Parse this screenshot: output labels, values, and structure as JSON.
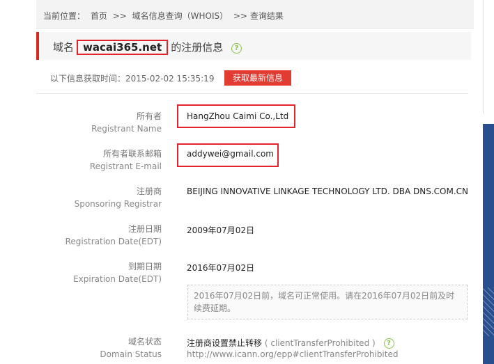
{
  "breadcrumb": {
    "prefix": "当前位置：",
    "home": "首页",
    "sep": ">>",
    "section": "域名信息查询（WHOIS）",
    "current": ">> 查询结果"
  },
  "title": {
    "prefix": "域名",
    "domain": "wacai365.net",
    "suffix": "的注册信息",
    "help": "?"
  },
  "fetch": {
    "text": "以下信息获取时间：2015-02-02 15:35:19",
    "button": "获取最新信息"
  },
  "fields": [
    {
      "label_cn": "所有者",
      "label_en": "Registrant Name",
      "value": "HangZhou Caimi Co.,Ltd"
    },
    {
      "label_cn": "所有者联系邮箱",
      "label_en": "Registrant E-mail",
      "value": "addywei@gmail.com"
    },
    {
      "label_cn": "注册商",
      "label_en": "Sponsoring Registrar",
      "value": "BEIJING INNOVATIVE LINKAGE TECHNOLOGY LTD. DBA DNS.COM.CN"
    },
    {
      "label_cn": "注册日期",
      "label_en": "Registration Date(EDT)",
      "value": "2009年07月02日"
    },
    {
      "label_cn": "到期日期",
      "label_en": "Expiration Date(EDT)",
      "value": "2016年07月02日"
    },
    {
      "label_cn": "域名状态",
      "label_en": "Domain Status",
      "value": "注册商设置禁止转移",
      "code": "( clientTransferProhibited )",
      "url": "http://www.icann.org/epp#clientTransferProhibited"
    }
  ],
  "expiry_note": "2016年07月02日前，域名可正常使用。请在2016年07月02日前及时续费延期。",
  "colors": {
    "accent": "#e3232b",
    "button": "#e23b32",
    "help": "#8bc34a"
  }
}
